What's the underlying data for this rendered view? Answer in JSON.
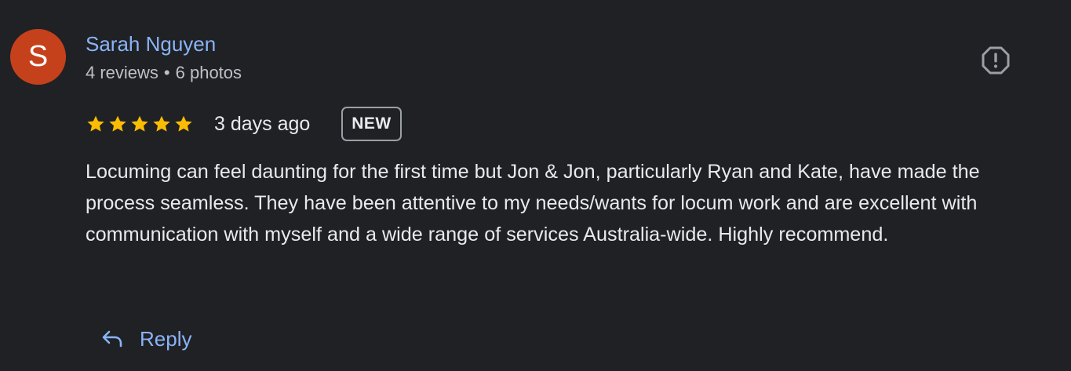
{
  "reviewer": {
    "avatar_letter": "S",
    "avatar_color": "#c5411c",
    "name": "Sarah Nguyen",
    "reviews": "4 reviews",
    "separator": "•",
    "photos": "6 photos"
  },
  "review": {
    "rating": 5,
    "rating_max": 5,
    "star_color": "#fbbc04",
    "date": "3 days ago",
    "badge": "NEW",
    "text": "Locuming can feel daunting for the first time but Jon & Jon, particularly Ryan and Kate, have made the process seamless. They have been attentive to my needs/wants for locum work and are excellent with communication with myself and a wide range of services Australia-wide. Highly recommend."
  },
  "actions": {
    "reply_label": "Reply",
    "reply_icon": "reply-arrow-icon",
    "report_icon": "report-octagon-icon"
  },
  "colors": {
    "background": "#202124",
    "link": "#8ab4f8"
  }
}
